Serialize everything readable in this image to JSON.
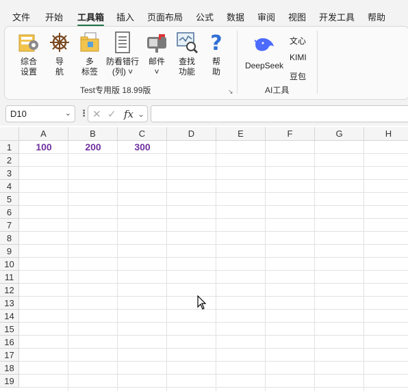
{
  "menu": {
    "items": [
      "文件",
      "开始",
      "工具箱",
      "插入",
      "页面布局",
      "公式",
      "数据",
      "审阅",
      "视图",
      "开发工具",
      "帮助"
    ],
    "active": "工具箱"
  },
  "ribbon": {
    "group1": {
      "buttons": [
        {
          "line1": "综合",
          "line2": "设置"
        },
        {
          "line1": "导",
          "line2": "航"
        },
        {
          "line1": "多",
          "line2": "标签"
        },
        {
          "line1": "防看错行",
          "line2": "(列) ˅"
        },
        {
          "line1": "邮件",
          "line2": "˅"
        },
        {
          "line1": "查找",
          "line2": "功能"
        },
        {
          "line1": "帮",
          "line2": "助"
        }
      ],
      "label": "Test专用版 18.99版",
      "launcher": "↘"
    },
    "group2": {
      "deepseek": "DeepSeek",
      "wenxin": "文心",
      "kimi": "KIMI",
      "doubao": "豆包",
      "label": "AI工具"
    }
  },
  "formula_bar": {
    "name_box": "D10",
    "dropdown": "⌄",
    "dots": "⋮",
    "cancel": "✕",
    "enter": "✓",
    "fx": "fx",
    "fx_dd": "⌄",
    "value": ""
  },
  "sheet": {
    "columns": [
      "A",
      "B",
      "C",
      "D",
      "E",
      "F",
      "G",
      "H"
    ],
    "rows": [
      "1",
      "2",
      "3",
      "4",
      "5",
      "6",
      "7",
      "8",
      "9",
      "10",
      "11",
      "12",
      "13",
      "14",
      "15",
      "16",
      "17",
      "18",
      "19"
    ],
    "row1": [
      "100",
      "200",
      "300"
    ]
  },
  "colors": {
    "accent": "#1e7145",
    "cell_text": "#7030a0"
  }
}
